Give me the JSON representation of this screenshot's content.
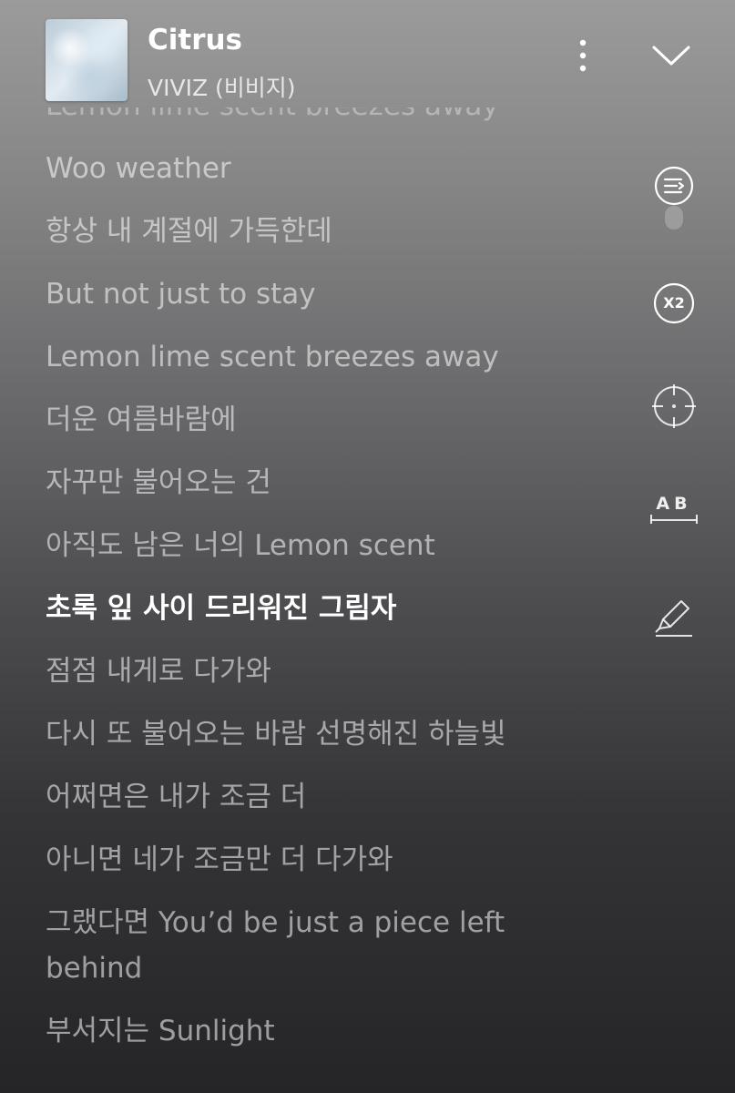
{
  "header": {
    "title": "Citrus",
    "artist": "VIVIZ (비비지)"
  },
  "lyrics": {
    "lines": [
      "Lemon lime scent breezes away",
      "Woo weather",
      "항상 내 계절에 가득한데",
      "But not just to stay",
      "Lemon lime scent breezes away",
      "더운 여름바람에",
      "자꾸만 불어오는 건",
      "아직도 남은 너의 Lemon scent",
      "초록 잎 사이 드리워진 그림자",
      "점점 내게로 다가와",
      "다시 또 불어오는 바람 선명해진 하늘빛",
      "어쩌면은 내가 조금 더",
      "아니면 네가 조금만 더 다가와",
      "그랬다면 You’d be just a piece left behind",
      "부서지는 Sunlight"
    ],
    "active_index": 8
  },
  "tools": {
    "speed_label": "X2",
    "ab_label": "AB"
  },
  "icons": [
    "album-art",
    "more-vertical-icon",
    "chevron-down-icon",
    "lyrics-queue-icon",
    "speed-x2-icon",
    "crosshair-icon",
    "ab-repeat-icon",
    "highlighter-pen-icon"
  ]
}
